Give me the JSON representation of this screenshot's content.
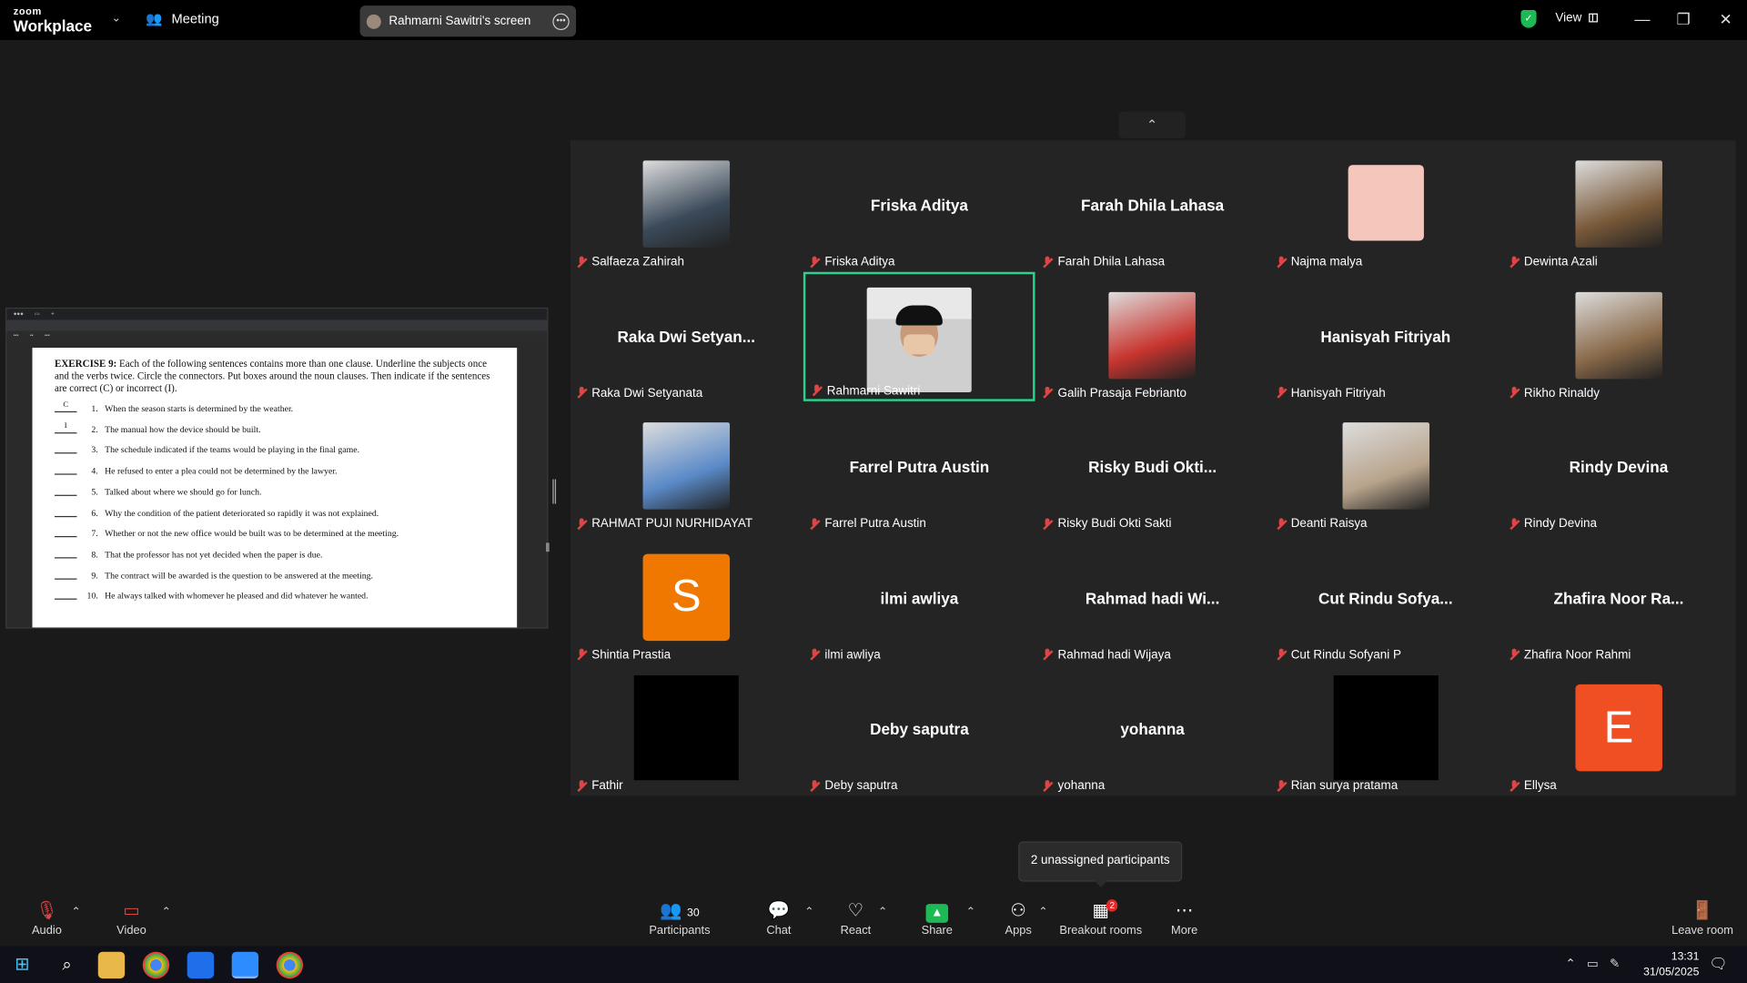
{
  "app": {
    "brand_top": "zoom",
    "brand_bottom": "Workplace",
    "meeting_label": "Meeting",
    "screen_owner": "Rahmarni Sawitri's screen",
    "view_label": "View"
  },
  "shared_doc": {
    "title_lead": "EXERCISE 9:",
    "title_rest": "Each of the following sentences contains more than one clause. Underline the subjects once and the verbs twice. Circle the connectors. Put boxes around the noun clauses. Then indicate if the sentences are correct (C) or incorrect (I).",
    "rows": [
      {
        "ans": "C",
        "num": "1.",
        "text": "When the season starts is determined by the weather."
      },
      {
        "ans": "I",
        "num": "2.",
        "text": "The manual how the device should be built."
      },
      {
        "ans": "",
        "num": "3.",
        "text": "The schedule indicated if the teams would be playing in the final game."
      },
      {
        "ans": "",
        "num": "4.",
        "text": "He refused to enter a plea could not be determined by the lawyer."
      },
      {
        "ans": "",
        "num": "5.",
        "text": "Talked about where we should go for lunch."
      },
      {
        "ans": "",
        "num": "6.",
        "text": "Why the condition of the patient deteriorated so rapidly it was not explained."
      },
      {
        "ans": "",
        "num": "7.",
        "text": "Whether or not the new office would be built was to be determined at the meeting."
      },
      {
        "ans": "",
        "num": "8.",
        "text": "That the professor has not yet decided when the paper is due."
      },
      {
        "ans": "",
        "num": "9.",
        "text": "The contract will be awarded is the question to be answered at the meeting."
      },
      {
        "ans": "",
        "num": "10.",
        "text": "He always talked with whomever he pleased and did whatever he wanted."
      }
    ]
  },
  "participants": [
    {
      "name": "Salfaeza Zahirah",
      "display": "",
      "kind": "photo",
      "color": "#3b4a5a"
    },
    {
      "name": "Friska Aditya",
      "display": "Friska Aditya",
      "kind": "text"
    },
    {
      "name": "Farah Dhila Lahasa",
      "display": "Farah Dhila Lahasa",
      "kind": "text"
    },
    {
      "name": "Najma malya",
      "display": "",
      "kind": "swatch",
      "color": "#f5c6bb"
    },
    {
      "name": "Dewinta Azali",
      "display": "",
      "kind": "photo",
      "color": "#7a5a3a"
    },
    {
      "name": "Raka Dwi Setyanata",
      "display": "Raka Dwi Setyan...",
      "kind": "text"
    },
    {
      "name": "Rahmarni Sawitri",
      "display": "",
      "kind": "video",
      "color": "#d9d9d9"
    },
    {
      "name": "Galih Prasaja Febrianto",
      "display": "",
      "kind": "photo",
      "color": "#c8352f"
    },
    {
      "name": "Hanisyah Fitriyah",
      "display": "Hanisyah Fitriyah",
      "kind": "text"
    },
    {
      "name": "Rikho Rinaldy",
      "display": "",
      "kind": "photo",
      "color": "#8a6a4a"
    },
    {
      "name": "RAHMAT PUJI NURHIDAYAT",
      "display": "",
      "kind": "photo",
      "color": "#5a8ac8"
    },
    {
      "name": "Farrel Putra Austin",
      "display": "Farrel Putra Austin",
      "kind": "text"
    },
    {
      "name": "Risky Budi Okti Sakti",
      "display": "Risky Budi Okti...",
      "kind": "text"
    },
    {
      "name": "Deanti Raisya",
      "display": "",
      "kind": "photo",
      "color": "#b8a48c"
    },
    {
      "name": "Rindy Devina",
      "display": "Rindy Devina",
      "kind": "text"
    },
    {
      "name": "Shintia Prastia",
      "display": "",
      "kind": "letter",
      "letter": "S",
      "color": "#f07800"
    },
    {
      "name": "ilmi awliya",
      "display": "ilmi awliya",
      "kind": "text"
    },
    {
      "name": "Rahmad hadi Wijaya",
      "display": "Rahmad hadi Wi...",
      "kind": "text"
    },
    {
      "name": "Cut Rindu Sofyani P",
      "display": "Cut Rindu Sofya...",
      "kind": "text"
    },
    {
      "name": "Zhafira Noor Rahmi",
      "display": "Zhafira Noor Ra...",
      "kind": "text"
    },
    {
      "name": "Fathir",
      "display": "",
      "kind": "black"
    },
    {
      "name": "Deby saputra",
      "display": "Deby saputra",
      "kind": "text"
    },
    {
      "name": "yohanna",
      "display": "yohanna",
      "kind": "text"
    },
    {
      "name": "Rian surya pratama",
      "display": "",
      "kind": "black"
    },
    {
      "name": "Ellysa",
      "display": "",
      "kind": "letter",
      "letter": "E",
      "color": "#f04e23"
    }
  ],
  "tooltip": "2 unassigned participants",
  "toolbar": {
    "audio": "Audio",
    "video": "Video",
    "participants": "Participants",
    "participants_count": "30",
    "chat": "Chat",
    "react": "React",
    "share": "Share",
    "apps": "Apps",
    "breakout": "Breakout rooms",
    "breakout_badge": "2",
    "more": "More",
    "leave": "Leave room"
  },
  "taskbar": {
    "time": "13:31",
    "date": "31/05/2025"
  },
  "colors": {
    "active_speaker": "#2ad28c",
    "share_green": "#1db954",
    "mute_red": "#e04545"
  }
}
